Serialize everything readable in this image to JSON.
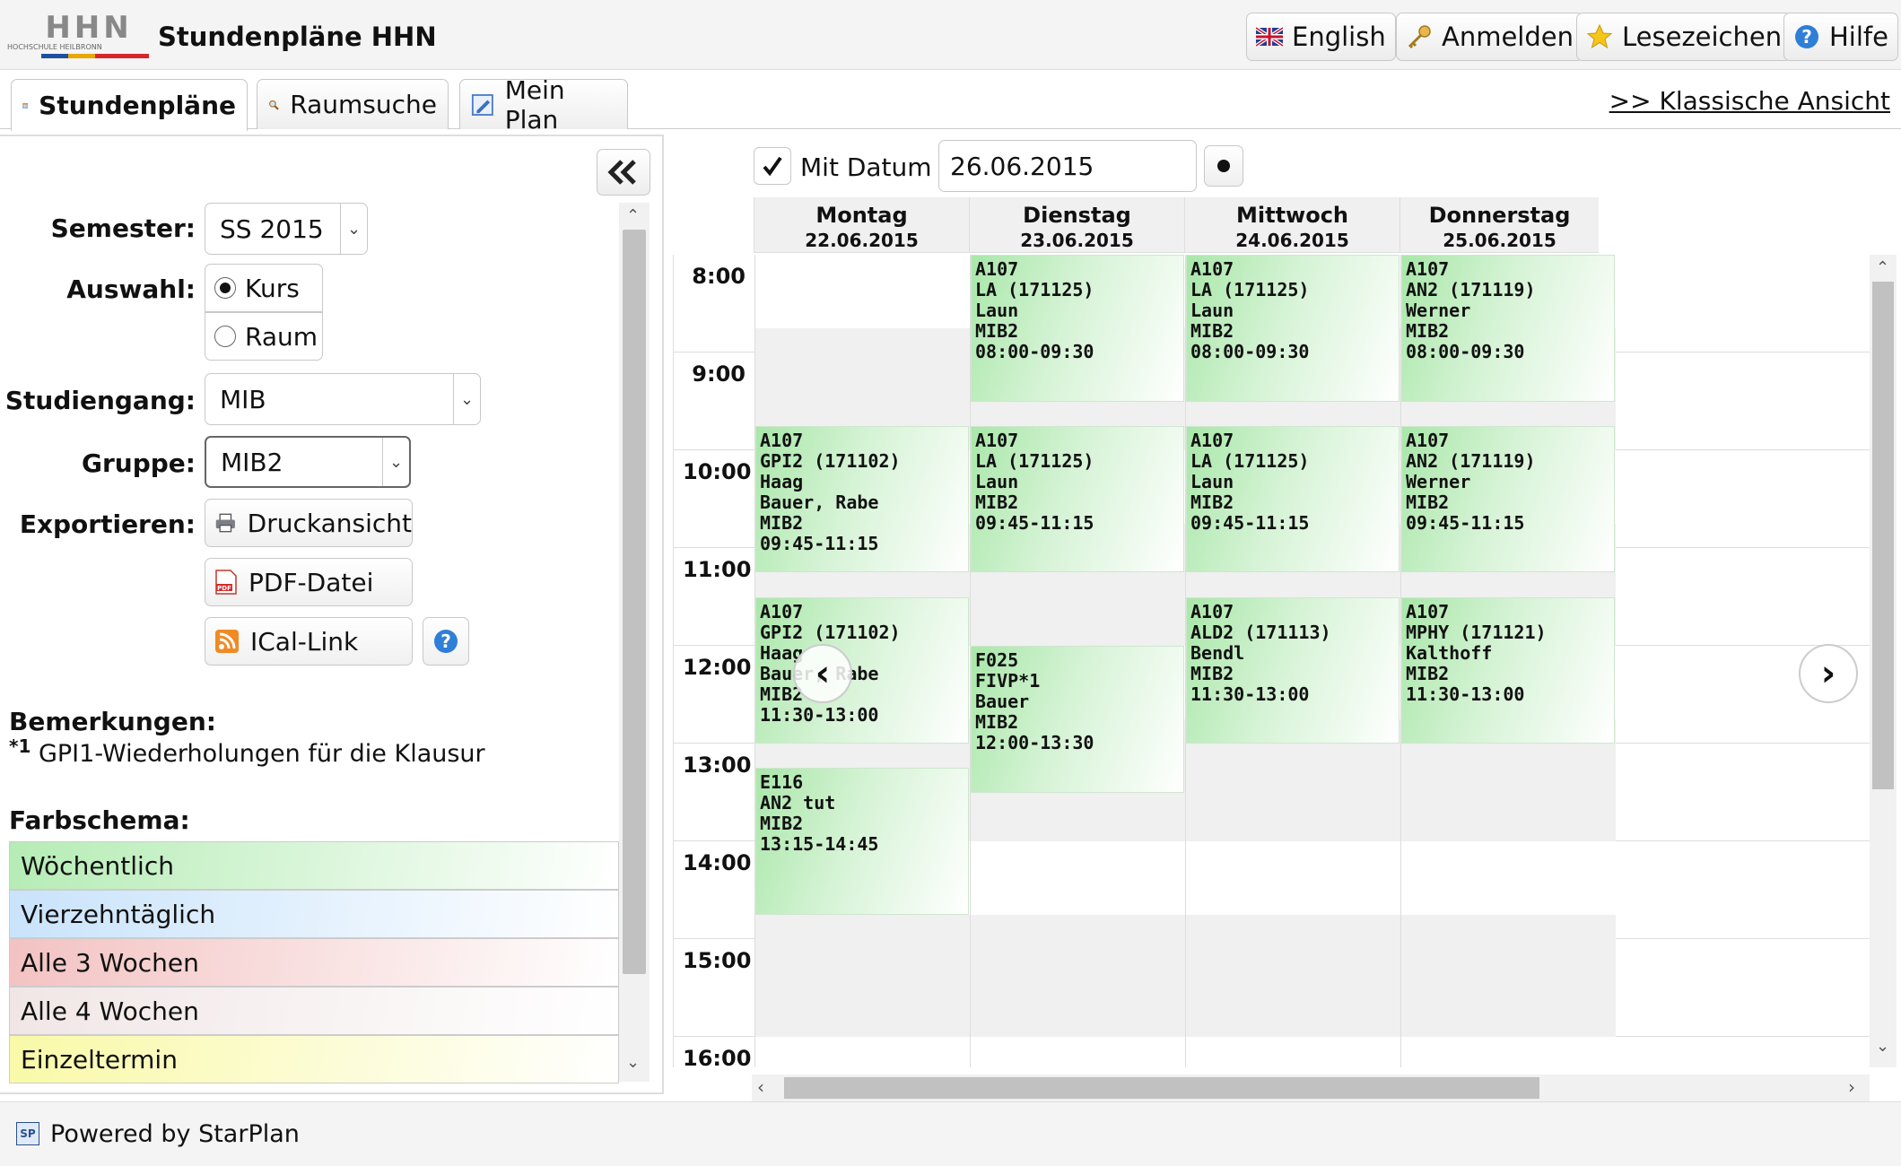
{
  "app": {
    "title": "Stundenpläne HHN",
    "logo_text": "HHN",
    "logo_sub": "HOCHSCHULE HEILBRONN"
  },
  "top_buttons": {
    "english": "English",
    "login": "Anmelden",
    "bookmarks": "Lesezeichen",
    "help": "Hilfe"
  },
  "tabs": {
    "schedules": "Stundenpläne",
    "room_search": "Raumsuche",
    "my_plan": "Mein Plan"
  },
  "classic_link": ">> Klassische Ansicht",
  "sidebar": {
    "collapse_icon": "double-chevron-left-icon",
    "semester_label": "Semester:",
    "semester_value": "SS 2015",
    "selection_label": "Auswahl:",
    "option_course": "Kurs",
    "option_room": "Raum",
    "program_label": "Studiengang:",
    "program_value": "MIB",
    "group_label": "Gruppe:",
    "group_value": "MIB2",
    "export_label": "Exportieren:",
    "print_view": "Druckansicht",
    "pdf_file": "PDF-Datei",
    "ical_link": "ICal-Link",
    "remarks_title": "Bemerkungen:",
    "remark_marker": "*1",
    "remark_text": "GPI1-Wiederholungen für die Klausur",
    "color_scheme_title": "Farbschema:",
    "legend": [
      {
        "label": "Wöchentlich",
        "color": "#b5ecb5"
      },
      {
        "label": "Vierzehntäglich",
        "color": "#c9e3fb"
      },
      {
        "label": "Alle 3 Wochen",
        "color": "#f3c2c2"
      },
      {
        "label": "Alle 4 Wochen",
        "color": "#f1e6e6"
      },
      {
        "label": "Einzeltermin",
        "color": "#f9f9a8"
      }
    ]
  },
  "date_bar": {
    "with_date_label": "Mit Datum",
    "date_value": "26.06.2015"
  },
  "calendar": {
    "days": [
      {
        "name": "Montag",
        "date": "22.06.2015"
      },
      {
        "name": "Dienstag",
        "date": "23.06.2015"
      },
      {
        "name": "Mittwoch",
        "date": "24.06.2015"
      },
      {
        "name": "Donnerstag",
        "date": "25.06.2015"
      }
    ],
    "hours": [
      "8:00",
      "9:00",
      "10:00",
      "11:00",
      "12:00",
      "13:00",
      "14:00",
      "15:00",
      "16:00"
    ],
    "events": [
      {
        "day": 1,
        "start": "08:00",
        "end": "09:30",
        "lines": [
          "A107",
          "LA (171125)",
          "Laun",
          "MIB2",
          "08:00-09:30"
        ]
      },
      {
        "day": 2,
        "start": "08:00",
        "end": "09:30",
        "lines": [
          "A107",
          "LA (171125)",
          "Laun",
          "MIB2",
          "08:00-09:30"
        ]
      },
      {
        "day": 3,
        "start": "08:00",
        "end": "09:30",
        "lines": [
          "A107",
          "AN2 (171119)",
          "Werner",
          "MIB2",
          "08:00-09:30"
        ]
      },
      {
        "day": 0,
        "start": "09:45",
        "end": "11:15",
        "lines": [
          "A107",
          "GPI2 (171102)",
          "Haag",
          "Bauer, Rabe",
          "MIB2",
          "09:45-11:15"
        ]
      },
      {
        "day": 1,
        "start": "09:45",
        "end": "11:15",
        "lines": [
          "A107",
          "LA (171125)",
          "Laun",
          "MIB2",
          "09:45-11:15"
        ]
      },
      {
        "day": 2,
        "start": "09:45",
        "end": "11:15",
        "lines": [
          "A107",
          "LA (171125)",
          "Laun",
          "MIB2",
          "09:45-11:15"
        ]
      },
      {
        "day": 3,
        "start": "09:45",
        "end": "11:15",
        "lines": [
          "A107",
          "AN2 (171119)",
          "Werner",
          "MIB2",
          "09:45-11:15"
        ]
      },
      {
        "day": 0,
        "start": "11:30",
        "end": "13:00",
        "lines": [
          "A107",
          "GPI2 (171102)",
          "Haag",
          "Bauer, Rabe",
          "MIB2",
          "11:30-13:00"
        ]
      },
      {
        "day": 2,
        "start": "11:30",
        "end": "13:00",
        "lines": [
          "A107",
          "ALD2 (171113)",
          "Bendl",
          "MIB2",
          "11:30-13:00"
        ]
      },
      {
        "day": 3,
        "start": "11:30",
        "end": "13:00",
        "lines": [
          "A107",
          "MPHY (171121)",
          "Kalthoff",
          "MIB2",
          "11:30-13:00"
        ]
      },
      {
        "day": 1,
        "start": "12:00",
        "end": "13:30",
        "lines": [
          "F025",
          "FIVP*1",
          "Bauer",
          "MIB2",
          "12:00-13:30"
        ]
      },
      {
        "day": 0,
        "start": "13:15",
        "end": "14:45",
        "lines": [
          "E116",
          "AN2 tut",
          "MIB2",
          "13:15-14:45"
        ]
      }
    ]
  },
  "status_bar": {
    "powered_by": "Powered by StarPlan",
    "logo_text": "SP"
  }
}
